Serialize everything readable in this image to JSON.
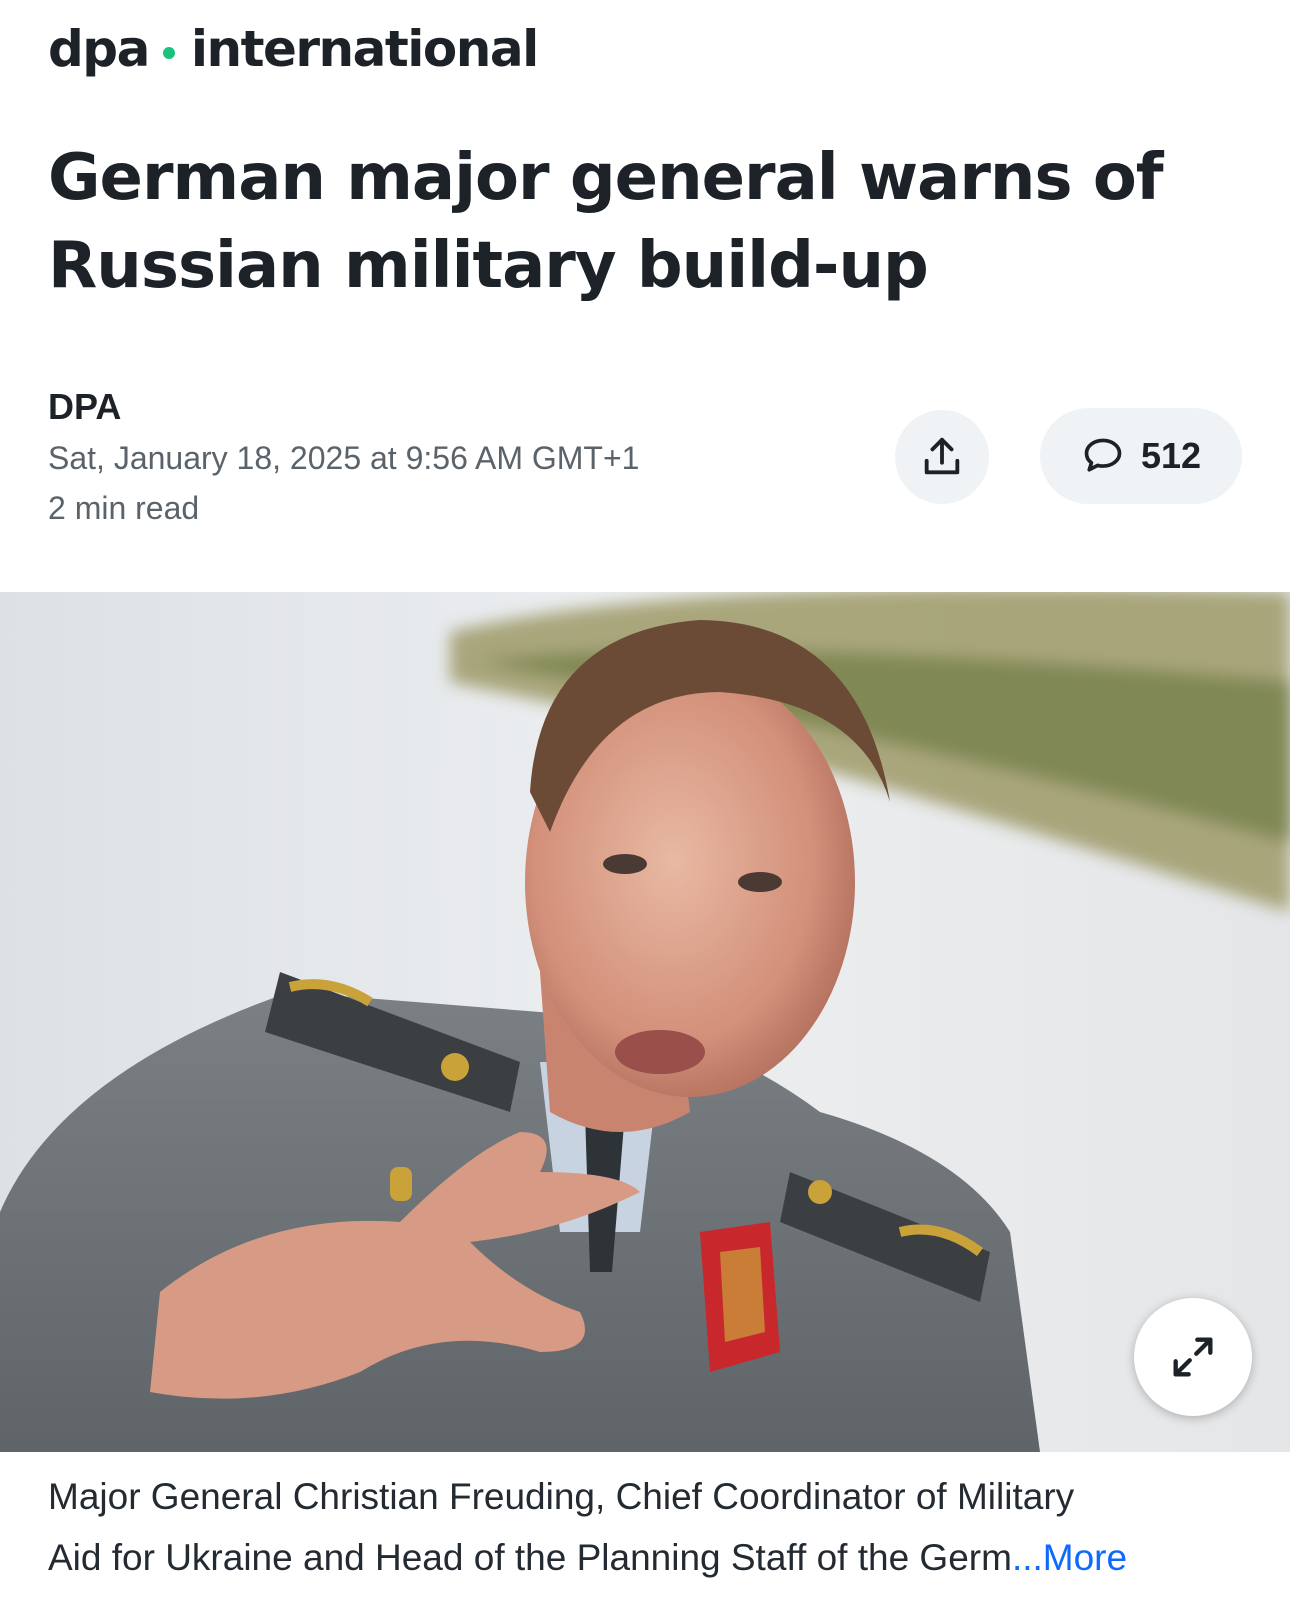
{
  "brand": {
    "left": "dpa",
    "right": "international",
    "dot_color": "#19c37d"
  },
  "article": {
    "headline": "German major general warns of Russian military build-up",
    "author": "DPA",
    "date": "Sat, January 18, 2025 at 9:56 AM GMT+1",
    "read_time": "2 min read"
  },
  "actions": {
    "share_icon": "share-icon",
    "comments_icon": "comment-bubble-icon",
    "comment_count": "512"
  },
  "photo": {
    "expand_icon": "expand-icon"
  },
  "caption": {
    "line1": "Major General Christian Freuding, Chief Coordinator of Military",
    "line2": "Aid for Ukraine and Head of the Planning Staff of the Germ",
    "more_label": "...More"
  },
  "colors": {
    "text": "#1d2228",
    "secondary_text": "#5b636a",
    "link": "#0f69ff",
    "button_bg": "#f0f3f5"
  }
}
